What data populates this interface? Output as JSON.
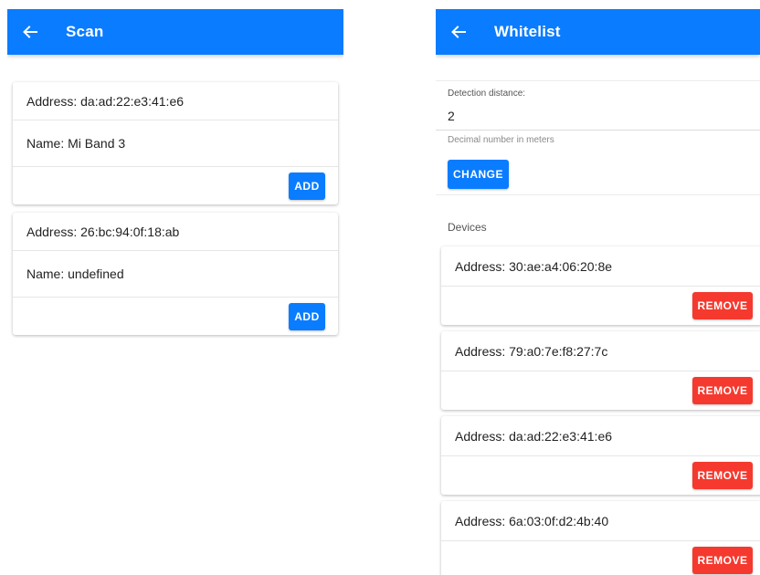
{
  "scan": {
    "title": "Scan",
    "colors": {
      "appbar": "#0a7cff",
      "add_button": "#0a7cff"
    },
    "devices": [
      {
        "address": "Address: da:ad:22:e3:41:e6",
        "name": "Name: Mi Band 3",
        "action": "ADD"
      },
      {
        "address": "Address: 26:bc:94:0f:18:ab",
        "name": "Name: undefined",
        "action": "ADD"
      }
    ]
  },
  "whitelist": {
    "title": "Whitelist",
    "colors": {
      "appbar": "#0a7cff",
      "change_button": "#0a7cff",
      "remove_button": "#f5392e"
    },
    "detection": {
      "label": "Detection distance:",
      "value": "2",
      "hint": "Decimal number in meters",
      "button": "CHANGE"
    },
    "devices_heading": "Devices",
    "devices": [
      {
        "address": "Address: 30:ae:a4:06:20:8e",
        "action": "REMOVE"
      },
      {
        "address": "Address: 79:a0:7e:f8:27:7c",
        "action": "REMOVE"
      },
      {
        "address": "Address: da:ad:22:e3:41:e6",
        "action": "REMOVE"
      },
      {
        "address": "Address: 6a:03:0f:d2:4b:40",
        "action": "REMOVE"
      }
    ]
  }
}
